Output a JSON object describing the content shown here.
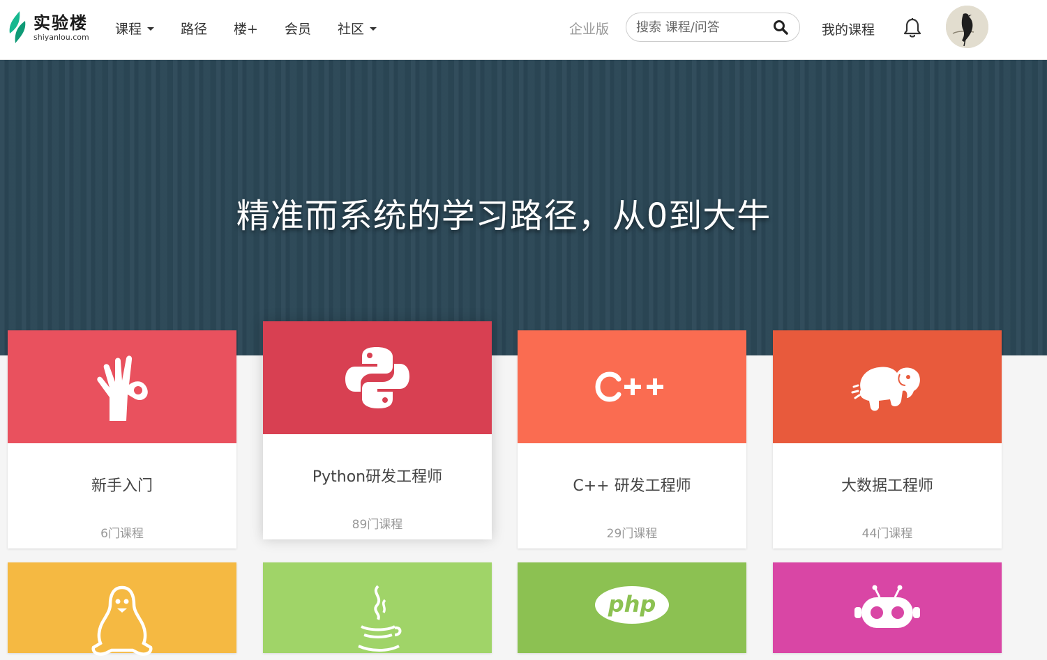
{
  "nav": {
    "logo_cn": "实验楼",
    "logo_en": "shiyanlou.com",
    "items": [
      {
        "label": "课程",
        "dropdown": true
      },
      {
        "label": "路径",
        "dropdown": false
      },
      {
        "label": "楼+",
        "dropdown": false
      },
      {
        "label": "会员",
        "dropdown": false
      },
      {
        "label": "社区",
        "dropdown": true
      }
    ],
    "enterprise": "企业版",
    "search_placeholder": "搜索 课程/问答",
    "my_courses": "我的课程"
  },
  "hero": {
    "title": "精准而系统的学习路径，从0到大牛"
  },
  "paths": [
    {
      "title": "新手入门",
      "count": "6门课程",
      "color": "#e9515e",
      "icon": "ok-hand-icon"
    },
    {
      "title": "Python研发工程师",
      "count": "89门课程",
      "color": "#d84052",
      "icon": "python-icon"
    },
    {
      "title": "C++ 研发工程师",
      "count": "29门课程",
      "color": "#fa6c51",
      "icon": "cpp-icon"
    },
    {
      "title": "大数据工程师",
      "count": "44门课程",
      "color": "#e85a3c",
      "icon": "hadoop-elephant-icon"
    },
    {
      "title": "",
      "count": "",
      "color": "#f5b942",
      "icon": "linux-penguin-icon"
    },
    {
      "title": "",
      "count": "",
      "color": "#a0d468",
      "icon": "java-cup-icon"
    },
    {
      "title": "",
      "count": "",
      "color": "#8cc152",
      "icon": "php-icon"
    },
    {
      "title": "",
      "count": "",
      "color": "#d946a5",
      "icon": "robot-icon"
    }
  ]
}
